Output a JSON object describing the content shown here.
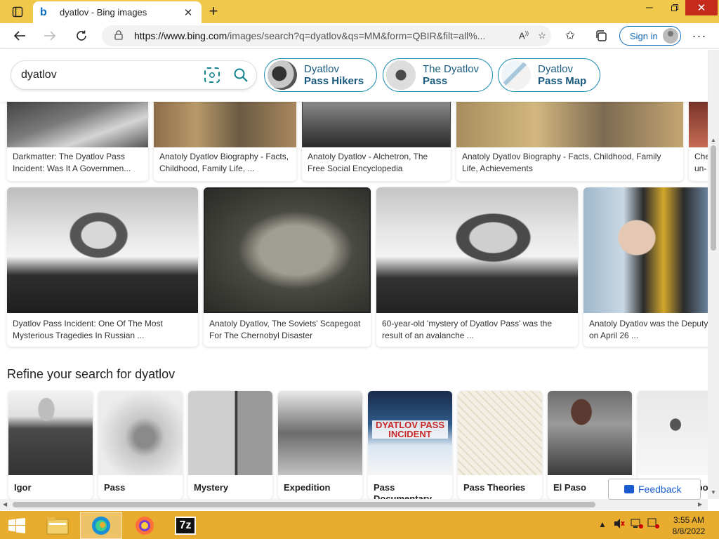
{
  "browser": {
    "tab_title": "dyatlov - Bing images",
    "url_prefix": "https://www.bing.com",
    "url_rest": "/images/search?q=dyatlov&qs=MM&form=QBIR&filt=all%...",
    "signin_label": "Sign in"
  },
  "search": {
    "query": "dyatlov"
  },
  "pills": [
    {
      "line1": "Dyatlov",
      "line2": "Pass Hikers"
    },
    {
      "line1": "The Dyatlov",
      "line2": "Pass"
    },
    {
      "line1": "Dyatlov",
      "line2": "Pass Map"
    }
  ],
  "results_row1": [
    {
      "caption": "Darkmatter: The Dyatlov Pass Incident: Was It A Governmen..."
    },
    {
      "caption": "Anatoly Dyatlov Biography - Facts, Childhood, Family Life, ..."
    },
    {
      "caption": "Anatoly Dyatlov - Alchetron, The Free Social Encyclopedia"
    },
    {
      "caption": "Anatoly Dyatlov Biography - Facts, Childhood, Family Life, Achievements"
    },
    {
      "caption": "Che un-"
    }
  ],
  "results_row2": [
    {
      "caption": "Dyatlov Pass Incident: One Of The Most Mysterious Tragedies In Russian ..."
    },
    {
      "caption": "Anatoly Dyatlov, The Soviets' Scapegoat For The Chernobyl Disaster"
    },
    {
      "caption": "60-year-old 'mystery of Dyatlov Pass' was the result of an avalanche ..."
    },
    {
      "caption": "Anatoly Dyatlov was the Deputy on April 26 ..."
    }
  ],
  "refine": {
    "title": "Refine your search for dyatlov",
    "items": [
      {
        "label": "Igor"
      },
      {
        "label": "Pass"
      },
      {
        "label": "Mystery"
      },
      {
        "label": "Expedition"
      },
      {
        "label": "Pass Documentary"
      },
      {
        "label": "Pass Theories"
      },
      {
        "label": "El Paso"
      },
      {
        "label": "Spot"
      }
    ]
  },
  "feedback_label": "Feedback",
  "taskbar": {
    "time": "3:55 AM",
    "date": "8/8/2022",
    "sevenzip_label": "7z"
  }
}
